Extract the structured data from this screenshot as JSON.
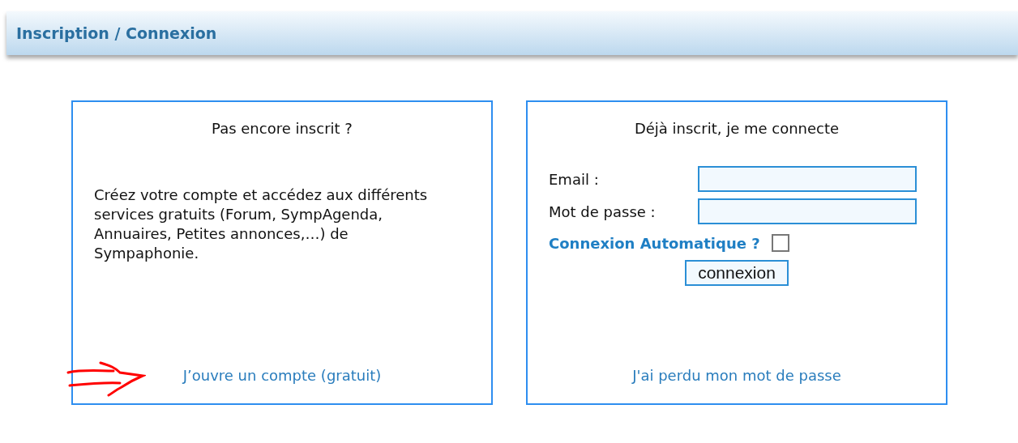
{
  "header": {
    "title": "Inscription / Connexion"
  },
  "signup": {
    "title": "Pas encore inscrit ?",
    "text": "Créez votre compte et accédez aux différents services gratuits (Forum, SympAgenda, Annuaires, Petites annonces,…) de Sympaphonie.",
    "link": "J’ouvre un compte (gratuit)",
    "annotated": true
  },
  "login": {
    "title": "Déjà inscrit, je me connecte",
    "fields": [
      {
        "label": "Email :"
      },
      {
        "label": "Mot de passe :"
      }
    ],
    "auto_login": {
      "label": "Connexion Automatique ?",
      "checked": false
    },
    "button": "connexion",
    "forgot_link": "J'ai perdu mon mot de passe"
  }
}
